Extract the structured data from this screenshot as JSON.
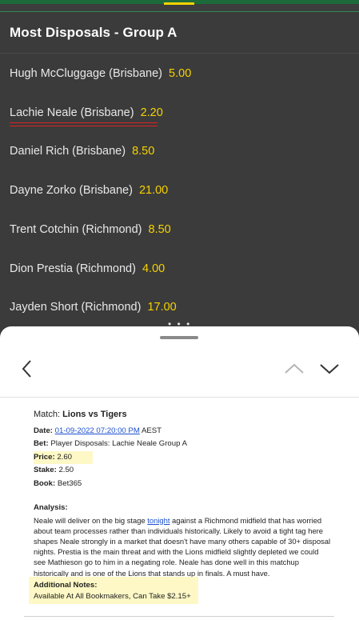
{
  "market": {
    "title": "Most Disposals - Group A"
  },
  "selections": [
    {
      "player": "Hugh McCluggage (Brisbane)",
      "odds": "5.00"
    },
    {
      "player": "Lachie Neale (Brisbane)",
      "odds": "2.20"
    },
    {
      "player": "Daniel Rich (Brisbane)",
      "odds": "8.50"
    },
    {
      "player": "Dayne Zorko (Brisbane)",
      "odds": "21.00"
    },
    {
      "player": "Trent Cotchin (Richmond)",
      "odds": "8.50"
    },
    {
      "player": "Dion Prestia (Richmond)",
      "odds": "4.00"
    },
    {
      "player": "Jayden Short (Richmond)",
      "odds": "17.00"
    }
  ],
  "sheet": {
    "overflow_dots": "• • •",
    "match_label": "Match:",
    "match_value": "Lions vs Tigers",
    "date_label": "Date:",
    "date_value": "01-09-2022 07:20:00 PM",
    "date_tz": "AEST",
    "bet_label": "Bet:",
    "bet_value": "Player Disposals: Lachie Neale Group A",
    "price_label": "Price:",
    "price_value": "2.60",
    "stake_label": "Stake:",
    "stake_value": "2.50",
    "book_label": "Book:",
    "book_value": "Bet365",
    "analysis_label": "Analysis:",
    "analysis_pre": "Neale will deliver on the big stage ",
    "analysis_link": "tonight",
    "analysis_post": " against a Richmond midfield that has worried about team processes rather than individuals historically. Likely to avoid a tight tag here shapes Neale strongly in a market that doesn't have many others capable of 30+ disposal nights. Prestia is the main threat and with the Lions midfield slightly depleted we could see Mathieson go to him in a negating role. Neale has done well in this matchup historically and is one of the Lions that stands up in finals. A must have.",
    "notes_label": "Additional Notes:",
    "notes_value": "Available At All Bookmakers, Can Take $2.15+"
  },
  "colors": {
    "odds": "#f6d200",
    "accent_green": "#1d6b3a",
    "highlight": "#fdf8c6",
    "link": "#1a4fd0"
  },
  "icons": {
    "back": "chevron-left-icon",
    "up": "chevron-up-icon",
    "down": "chevron-down-icon"
  }
}
